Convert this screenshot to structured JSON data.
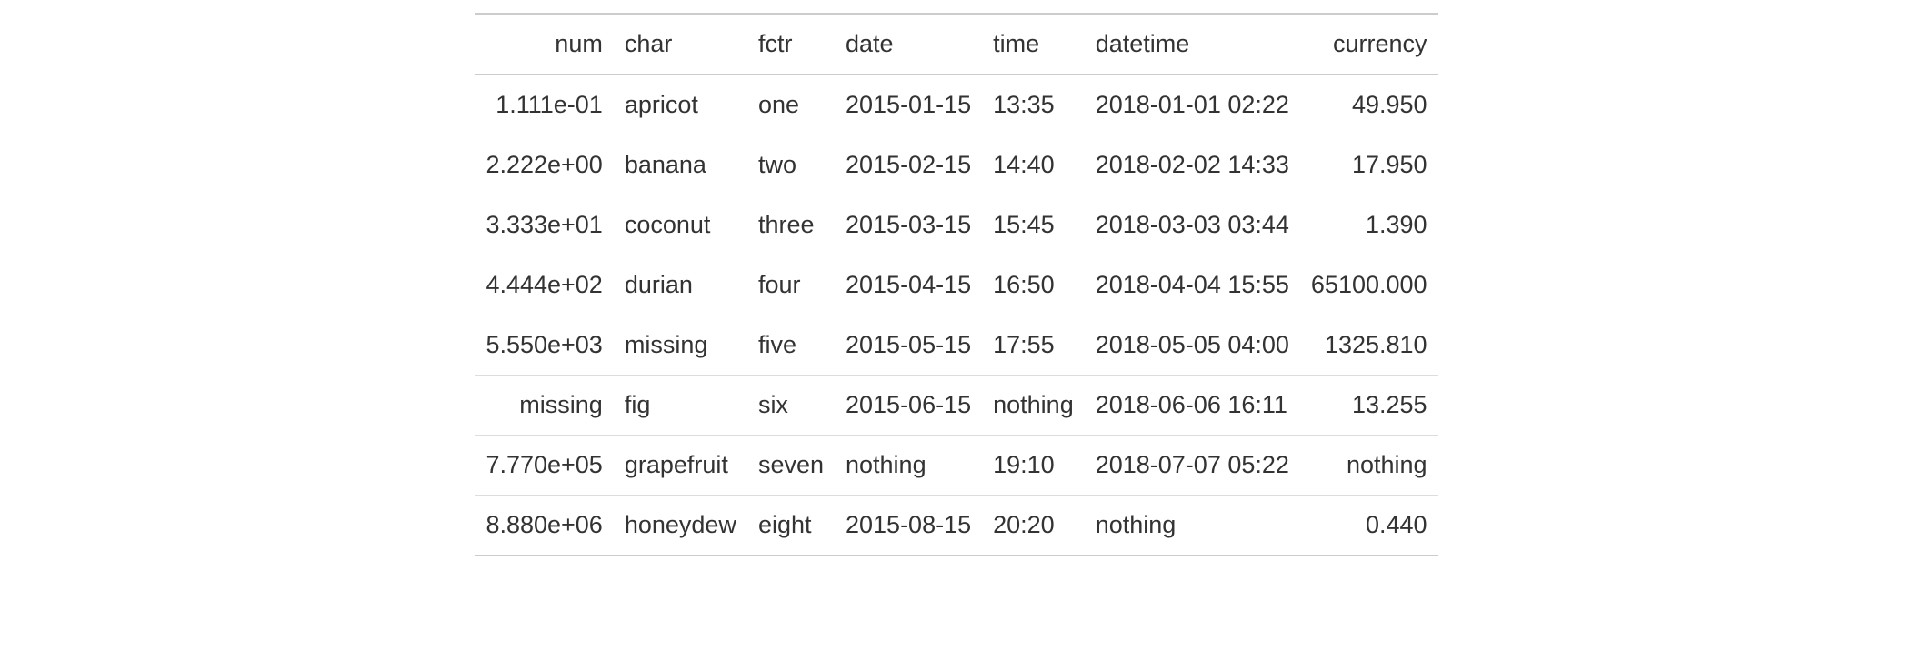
{
  "table": {
    "headers": {
      "num": "num",
      "char": "char",
      "fctr": "fctr",
      "date": "date",
      "time": "time",
      "datetime": "datetime",
      "currency": "currency"
    },
    "rows": [
      {
        "num": "1.111e-01",
        "char": "apricot",
        "fctr": "one",
        "date": "2015-01-15",
        "time": "13:35",
        "datetime": "2018-01-01 02:22",
        "currency": "49.950"
      },
      {
        "num": "2.222e+00",
        "char": "banana",
        "fctr": "two",
        "date": "2015-02-15",
        "time": "14:40",
        "datetime": "2018-02-02 14:33",
        "currency": "17.950"
      },
      {
        "num": "3.333e+01",
        "char": "coconut",
        "fctr": "three",
        "date": "2015-03-15",
        "time": "15:45",
        "datetime": "2018-03-03 03:44",
        "currency": "1.390"
      },
      {
        "num": "4.444e+02",
        "char": "durian",
        "fctr": "four",
        "date": "2015-04-15",
        "time": "16:50",
        "datetime": "2018-04-04 15:55",
        "currency": "65100.000"
      },
      {
        "num": "5.550e+03",
        "char": "missing",
        "fctr": "five",
        "date": "2015-05-15",
        "time": "17:55",
        "datetime": "2018-05-05 04:00",
        "currency": "1325.810"
      },
      {
        "num": "missing",
        "char": "fig",
        "fctr": "six",
        "date": "2015-06-15",
        "time": "nothing",
        "datetime": "2018-06-06 16:11",
        "currency": "13.255"
      },
      {
        "num": "7.770e+05",
        "char": "grapefruit",
        "fctr": "seven",
        "date": "nothing",
        "time": "19:10",
        "datetime": "2018-07-07 05:22",
        "currency": "nothing"
      },
      {
        "num": "8.880e+06",
        "char": "honeydew",
        "fctr": "eight",
        "date": "2015-08-15",
        "time": "20:20",
        "datetime": "nothing",
        "currency": "0.440"
      }
    ]
  }
}
